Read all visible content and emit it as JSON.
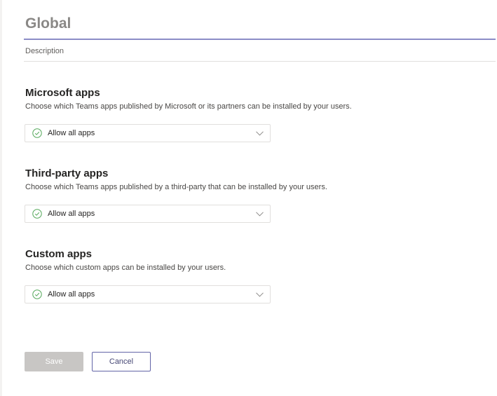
{
  "policy": {
    "name": "Global",
    "description_label": "Description"
  },
  "sections": [
    {
      "title": "Microsoft apps",
      "description": "Choose which Teams apps published by Microsoft or its partners can be installed by your users.",
      "selected_value": "Allow all apps"
    },
    {
      "title": "Third-party apps",
      "description": "Choose which Teams apps published by a third-party that can be installed by your users.",
      "selected_value": "Allow all apps"
    },
    {
      "title": "Custom apps",
      "description": "Choose which custom apps can be installed by your users.",
      "selected_value": "Allow all apps"
    }
  ],
  "actions": {
    "save_label": "Save",
    "save_enabled": false,
    "cancel_label": "Cancel"
  },
  "icons": {
    "selected_value_icon": "check-circle-icon",
    "dropdown_icon": "chevron-down-icon"
  },
  "colors": {
    "accent": "#6264a7",
    "check_green": "#54a85a",
    "disabled_button": "#c8c6c4"
  }
}
